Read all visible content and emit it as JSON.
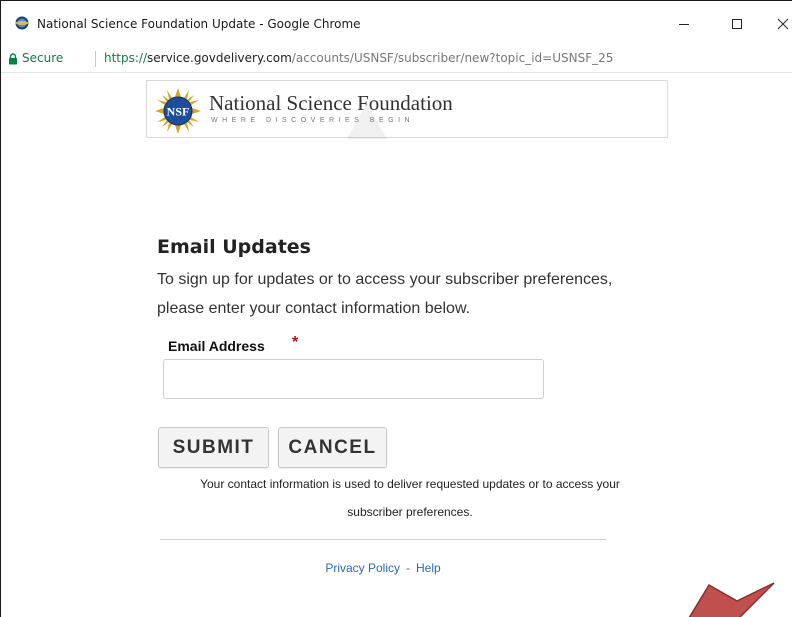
{
  "window": {
    "title": "National Science Foundation Update - Google Chrome",
    "minimize_icon": "minimize-icon",
    "maximize_icon": "maximize-icon",
    "close_icon": "close-icon"
  },
  "addressbar": {
    "secure_label": "Secure",
    "url_scheme": "https://",
    "url_host": "service.govdelivery.com",
    "url_path": "/accounts/USNSF/subscriber/new?topic_id=USNSF_25",
    "lock_icon": "lock-icon"
  },
  "banner": {
    "org_name": "National Science Foundation",
    "tagline": "WHERE DISCOVERIES BEGIN",
    "logo_text": "NSF"
  },
  "form": {
    "heading": "Email Updates",
    "intro_line1": "To sign up for updates or to access your subscriber preferences,",
    "intro_line2": "please enter your contact information below.",
    "email_label": "Email Address",
    "required_mark": "*",
    "email_value": "",
    "submit_label": "SUBMIT",
    "cancel_label": "CANCEL",
    "note_line1": "Your contact information is used to deliver requested updates or to access your",
    "note_line2": "subscriber preferences."
  },
  "footer": {
    "privacy_label": "Privacy Policy",
    "separator": "-",
    "help_label": "Help"
  },
  "colors": {
    "secure_green": "#0b8043",
    "link_blue": "#2a6ab3",
    "required_red": "#b5121b",
    "arrow_red": "#c0504d"
  }
}
